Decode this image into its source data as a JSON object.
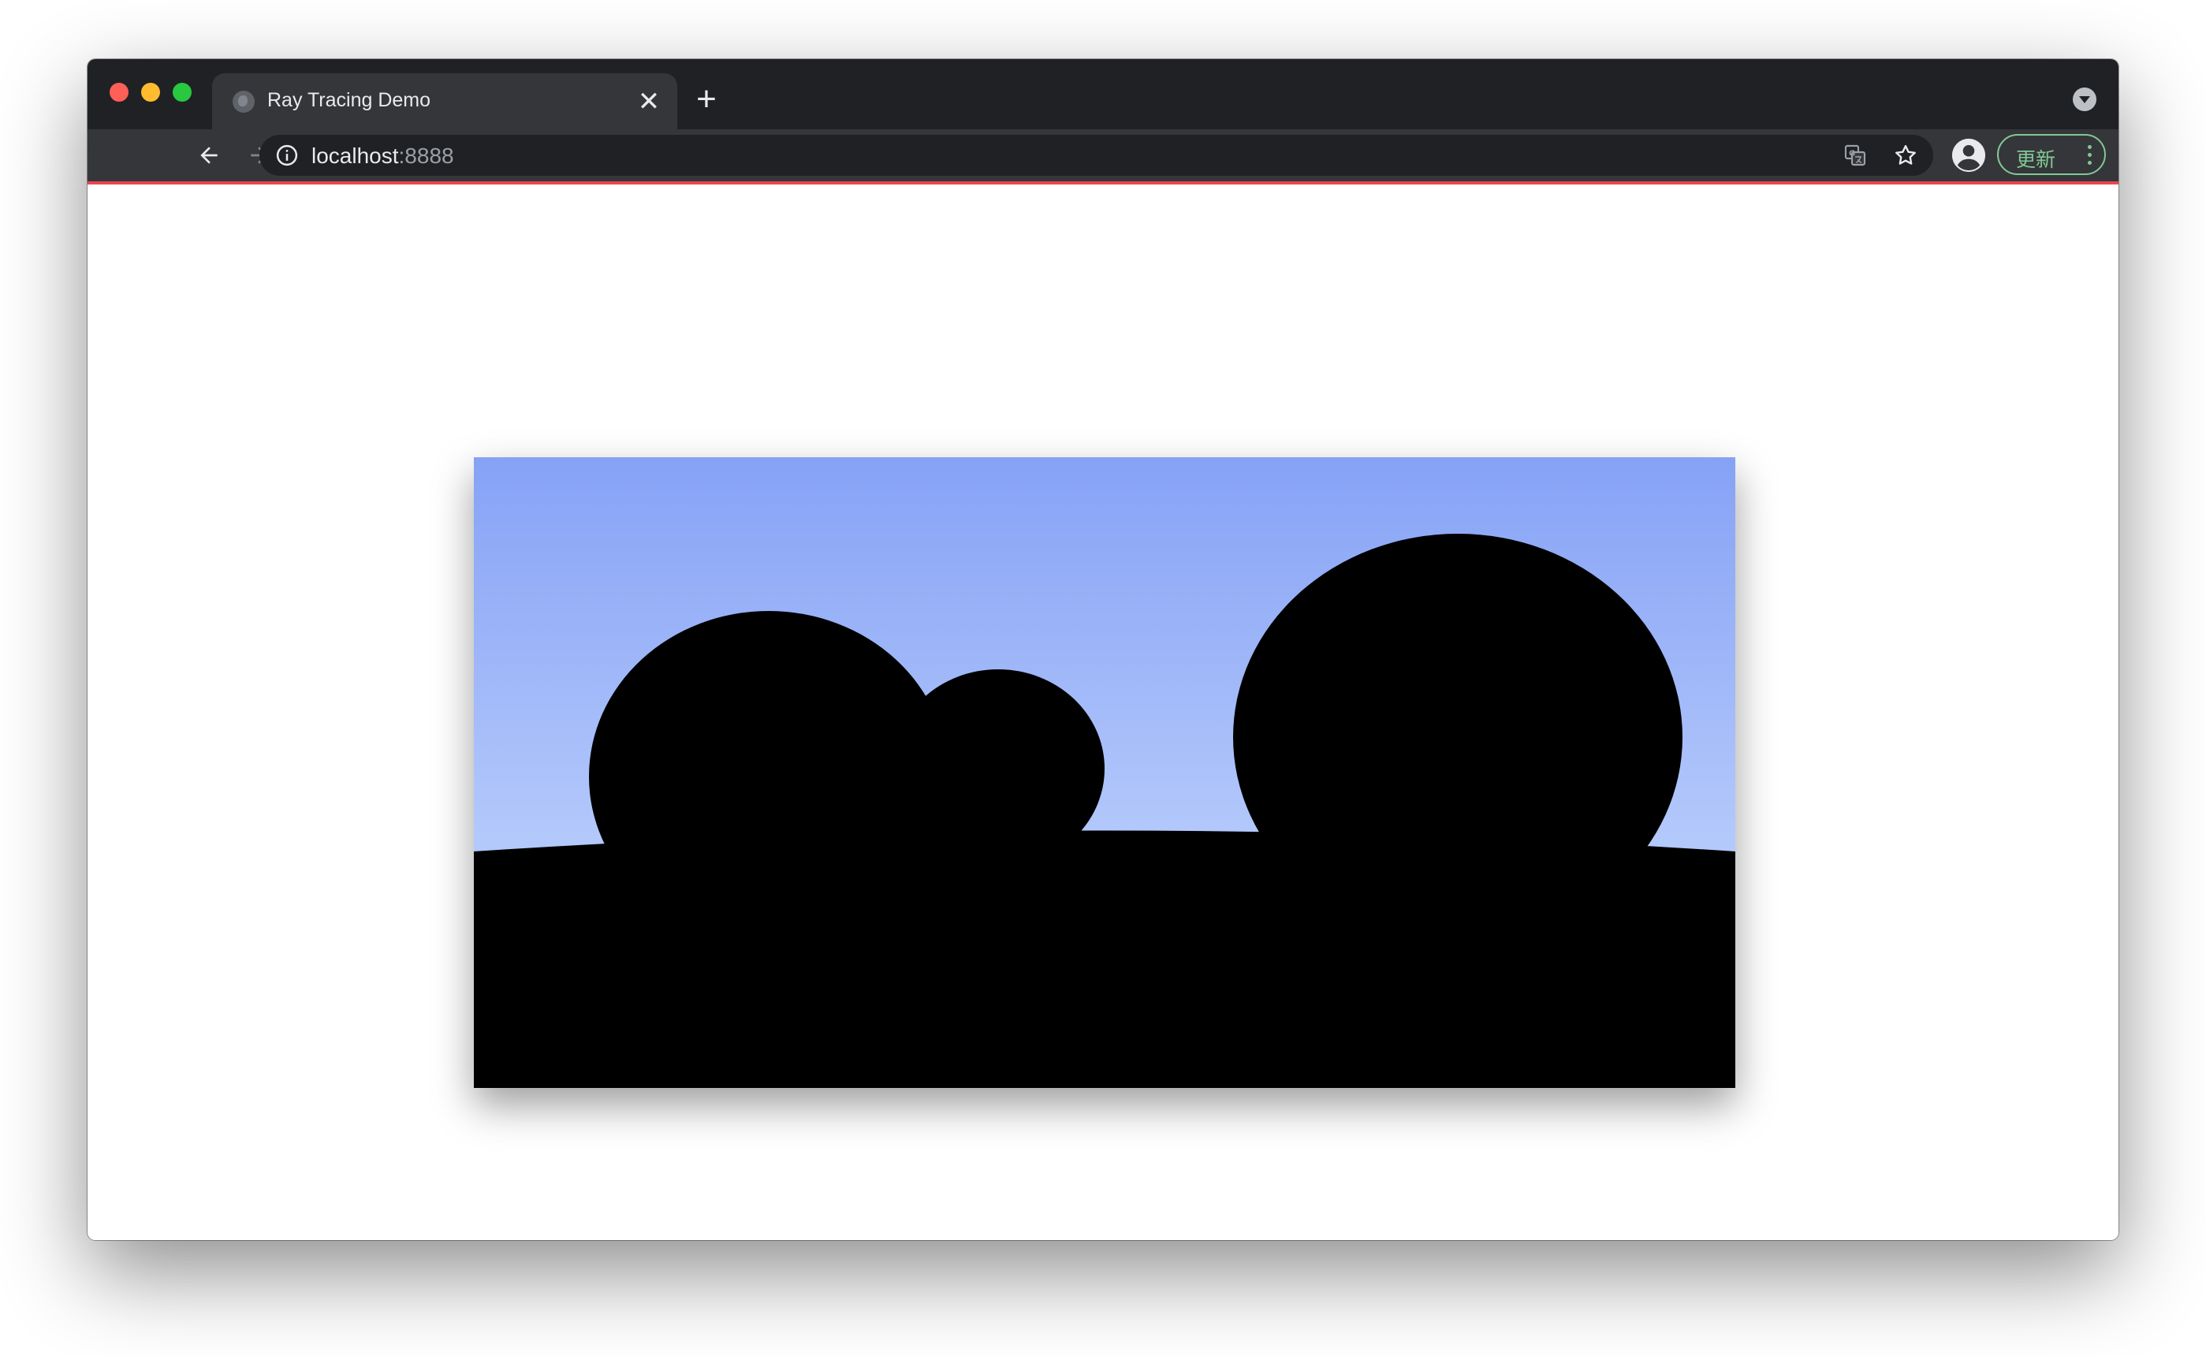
{
  "browser": {
    "tab": {
      "title": "Ray Tracing Demo",
      "close_glyph": "✕",
      "favicon": "globe-icon"
    },
    "new_tab_glyph": "+",
    "address": {
      "host": "localhost",
      "port": ":8888"
    },
    "update_label": "更新",
    "accent_line_color": "#e8464f"
  },
  "scene": {
    "sky_colors": [
      "#86a2f5",
      "#b3c8fb"
    ],
    "object_color": "#000000"
  }
}
